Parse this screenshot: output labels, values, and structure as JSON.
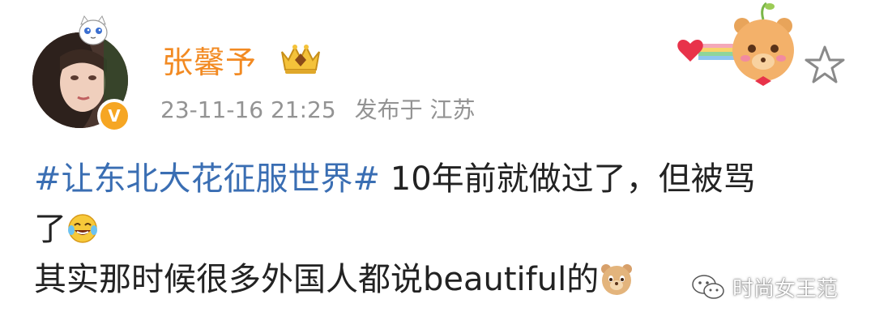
{
  "post": {
    "username": "张馨予",
    "timestamp": "23-11-16 21:25",
    "source": "发布于 江苏",
    "hashtag": "#让东北大花征服世界#",
    "text_line1_rest": " 10年前就做过了，但被骂",
    "text_line2": "了",
    "text_line3": "其实那时候很多外国人都说beautiful的"
  },
  "badges": {
    "verified": "V"
  },
  "watermark": {
    "label": "时尚女王范"
  },
  "colors": {
    "username": "#f28a22",
    "hashtag": "#3a6eb3",
    "meta": "#939393",
    "text": "#222222"
  },
  "icons": [
    "cat-decoration-icon",
    "verified-badge-icon",
    "crown-badge-icon",
    "bear-heart-rainbow-icon",
    "star-icon",
    "laughing-tears-emoji",
    "bear-face-emoji",
    "wechat-icon"
  ]
}
